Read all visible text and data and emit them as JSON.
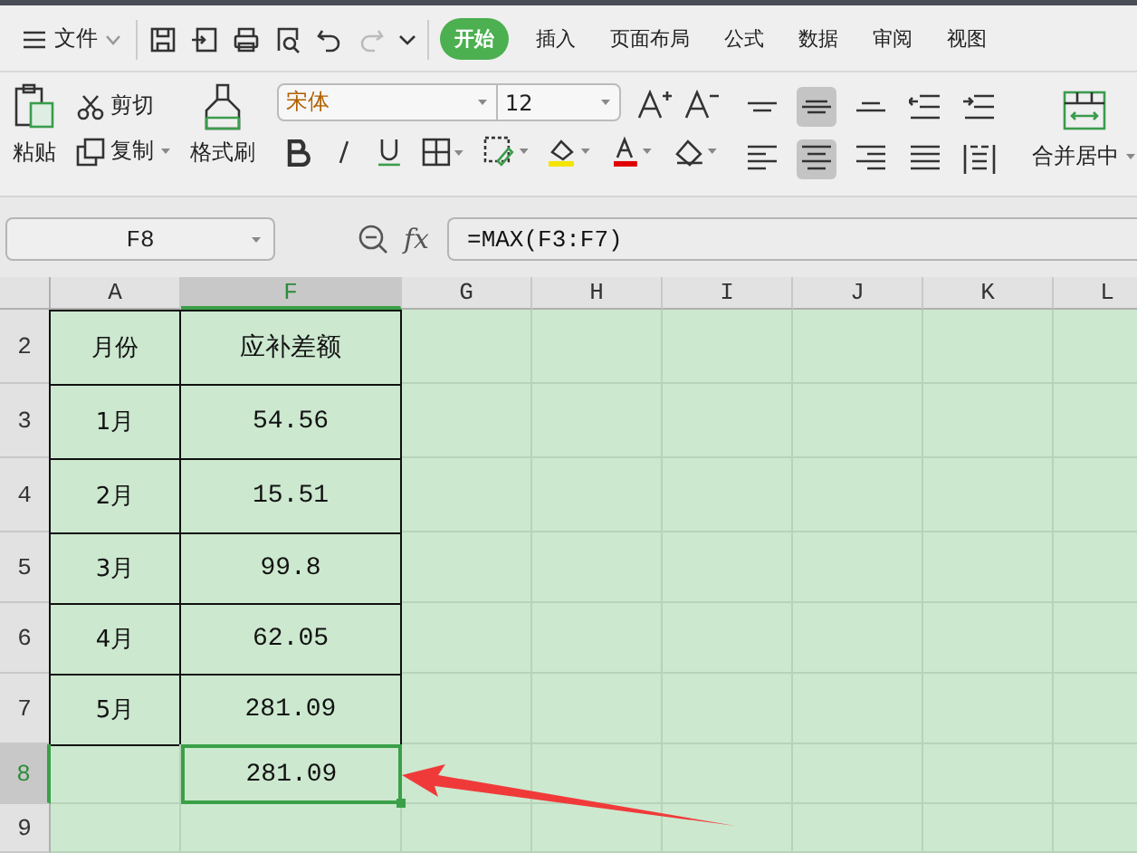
{
  "menu": {
    "file_label": "文件",
    "tabs": [
      {
        "label": "开始",
        "selected": true
      },
      {
        "label": "插入",
        "selected": false
      },
      {
        "label": "页面布局",
        "selected": false
      },
      {
        "label": "公式",
        "selected": false
      },
      {
        "label": "数据",
        "selected": false
      },
      {
        "label": "审阅",
        "selected": false
      },
      {
        "label": "视图",
        "selected": false
      }
    ]
  },
  "ribbon": {
    "paste": "粘贴",
    "cut": "剪切",
    "copy": "复制",
    "format_painter": "格式刷",
    "font_name": "宋体",
    "font_size": "12",
    "align_buttons": [
      {
        "kind": "top",
        "selected": false
      },
      {
        "kind": "middle",
        "selected": true
      },
      {
        "kind": "bottom",
        "selected": false
      },
      {
        "kind": "outdent",
        "selected": false
      },
      {
        "kind": "indent",
        "selected": false
      },
      {
        "kind": "left",
        "selected": false
      },
      {
        "kind": "center",
        "selected": true
      },
      {
        "kind": "right",
        "selected": false
      },
      {
        "kind": "justify",
        "selected": false
      },
      {
        "kind": "distributed",
        "selected": false
      }
    ],
    "merge": "合并居中"
  },
  "formula_bar": {
    "cell_ref": "F8",
    "function_label": "fx",
    "formula": "=MAX(F3:F7)"
  },
  "sheet": {
    "columns": [
      {
        "label": "A",
        "selected": false
      },
      {
        "label": "F",
        "selected": true
      },
      {
        "label": "G",
        "selected": false
      },
      {
        "label": "H",
        "selected": false
      },
      {
        "label": "I",
        "selected": false
      },
      {
        "label": "J",
        "selected": false
      },
      {
        "label": "K",
        "selected": false
      },
      {
        "label": "L",
        "selected": false
      }
    ],
    "rows": [
      {
        "number": "2",
        "selected": false,
        "bordered": true,
        "cells": [
          {
            "text": "月份",
            "active": false
          },
          {
            "text": "应补差额",
            "active": false
          }
        ]
      },
      {
        "number": "3",
        "selected": false,
        "bordered": true,
        "cells": [
          {
            "text": "1月",
            "active": false
          },
          {
            "text": "54.56",
            "active": false
          }
        ]
      },
      {
        "number": "4",
        "selected": false,
        "bordered": true,
        "cells": [
          {
            "text": "2月",
            "active": false
          },
          {
            "text": "15.51",
            "active": false
          }
        ]
      },
      {
        "number": "5",
        "selected": false,
        "bordered": true,
        "cells": [
          {
            "text": "3月",
            "active": false
          },
          {
            "text": "99.8",
            "active": false
          }
        ]
      },
      {
        "number": "6",
        "selected": false,
        "bordered": true,
        "cells": [
          {
            "text": "4月",
            "active": false
          },
          {
            "text": "62.05",
            "active": false
          }
        ]
      },
      {
        "number": "7",
        "selected": false,
        "bordered": true,
        "cells": [
          {
            "text": "5月",
            "active": false
          },
          {
            "text": "281.09",
            "active": false
          }
        ]
      },
      {
        "number": "8",
        "selected": true,
        "bordered": false,
        "cells": [
          {
            "active": false
          },
          {
            "text": "281.09",
            "active": true
          }
        ]
      },
      {
        "number": "9",
        "selected": false,
        "bordered": false,
        "cells": [
          {
            "active": false
          },
          {
            "active": false
          }
        ]
      }
    ]
  }
}
